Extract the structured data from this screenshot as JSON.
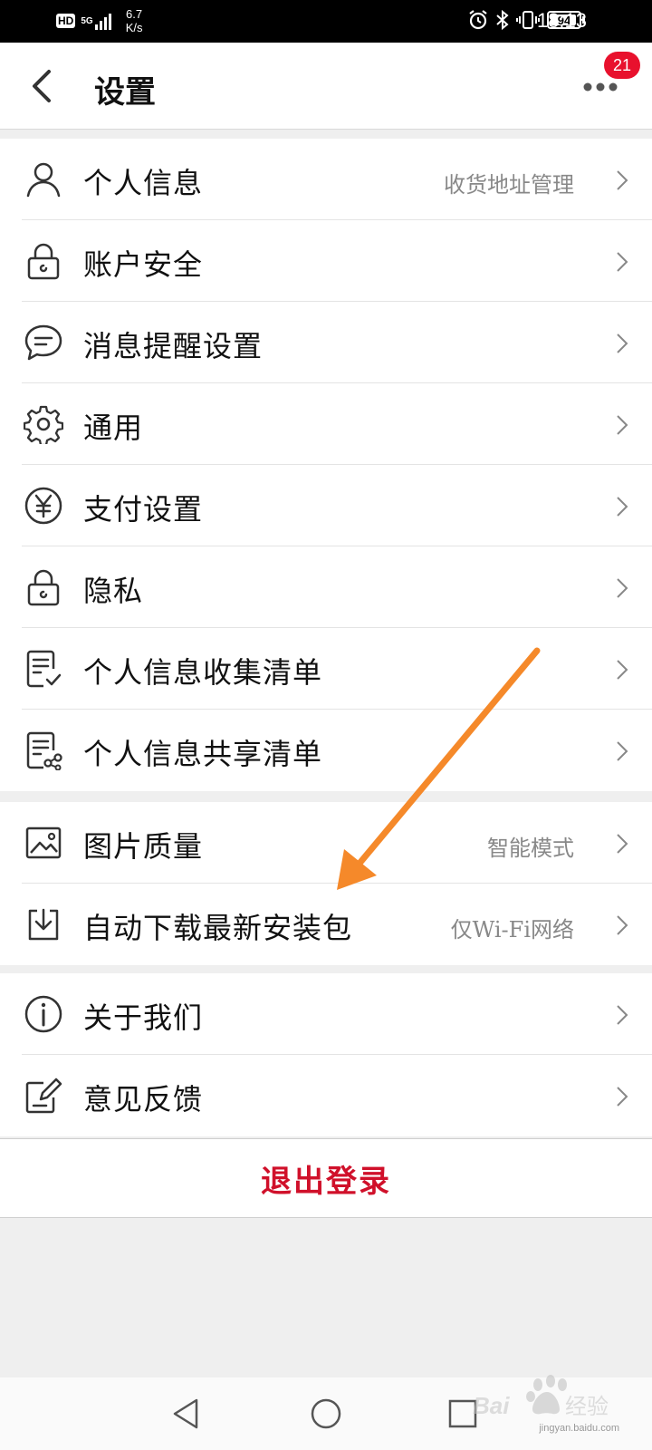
{
  "status_bar": {
    "hd_label": "HD",
    "network_type": "5G",
    "speed_value": "6.7",
    "speed_unit": "K/s",
    "battery_level": "94",
    "battery_fraction": 0.94,
    "time": "18:13"
  },
  "header": {
    "title": "设置",
    "badge_count": "21",
    "back_icon": "back-chevron-icon",
    "more_icon": "more-dots-icon"
  },
  "groups": [
    {
      "items": [
        {
          "label": "个人信息",
          "value": "收货地址管理",
          "icon": "person-icon"
        },
        {
          "label": "账户安全",
          "value": "",
          "icon": "lock-icon"
        },
        {
          "label": "消息提醒设置",
          "value": "",
          "icon": "chat-bubble-icon"
        },
        {
          "label": "通用",
          "value": "",
          "icon": "gear-icon"
        },
        {
          "label": "支付设置",
          "value": "",
          "icon": "yen-icon"
        },
        {
          "label": "隐私",
          "value": "",
          "icon": "lock-icon"
        },
        {
          "label": "个人信息收集清单",
          "value": "",
          "icon": "checklist-icon"
        },
        {
          "label": "个人信息共享清单",
          "value": "",
          "icon": "share-list-icon"
        }
      ]
    },
    {
      "items": [
        {
          "label": "图片质量",
          "value": "智能模式",
          "icon": "image-icon"
        },
        {
          "label": "自动下载最新安装包",
          "value": "仅Wi-Fi网络",
          "icon": "download-icon"
        }
      ]
    },
    {
      "items": [
        {
          "label": "关于我们",
          "value": "",
          "icon": "info-icon"
        },
        {
          "label": "意见反馈",
          "value": "",
          "icon": "edit-icon"
        }
      ]
    }
  ],
  "logout": {
    "label": "退出登录"
  },
  "nav": {
    "back_icon": "nav-back-icon",
    "home_icon": "nav-home-icon",
    "recent_icon": "nav-recent-icon"
  },
  "watermark": {
    "brand": "Bai du 经验",
    "url": "jingyan.baidu.com"
  },
  "colors": {
    "accent": "#d0102a",
    "badge": "#e8112d",
    "annotation_arrow": "#f5892a"
  }
}
